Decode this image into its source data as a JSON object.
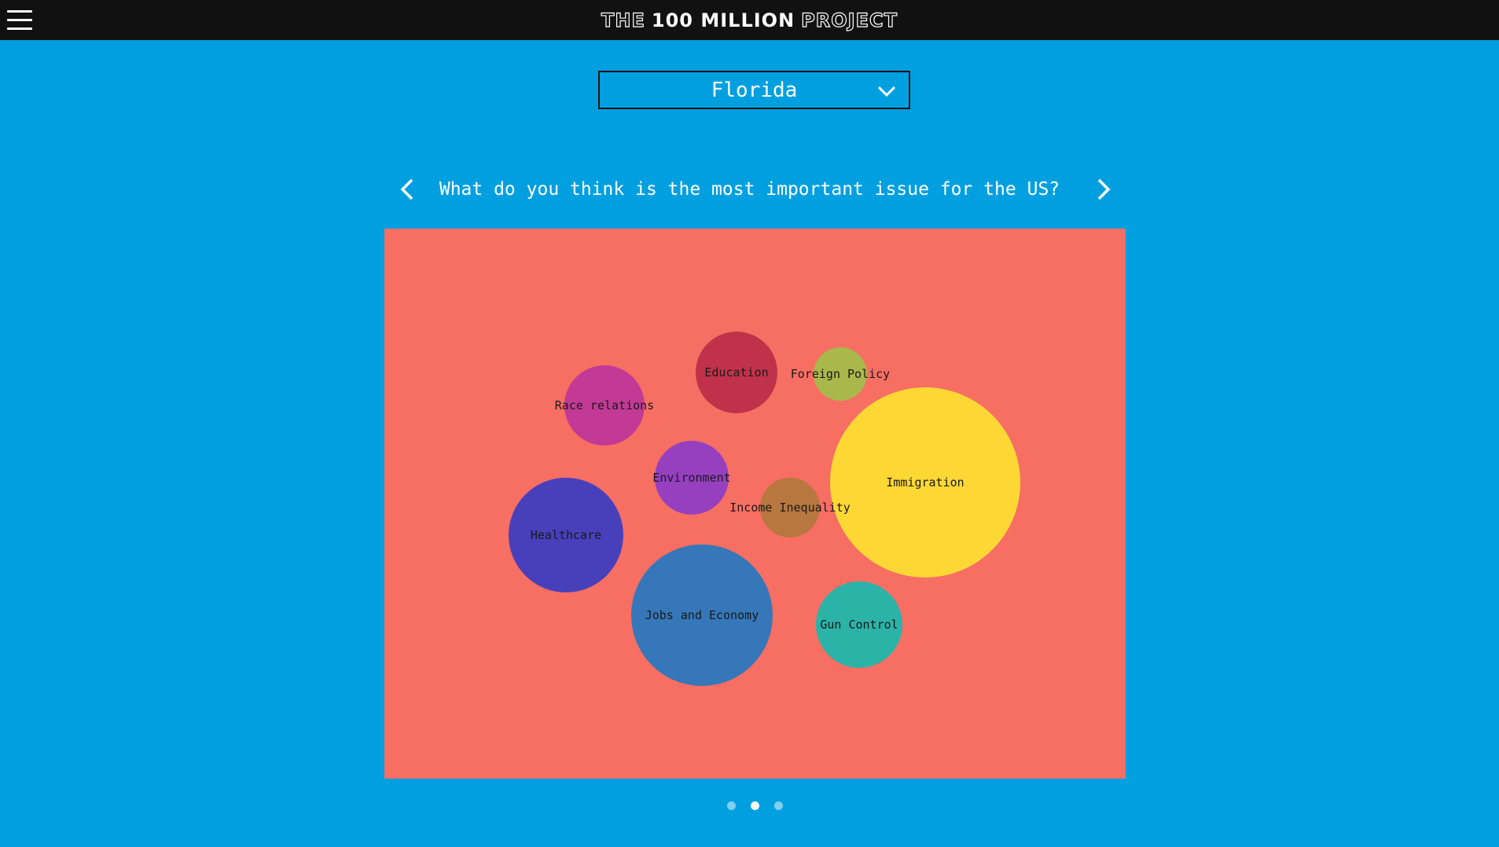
{
  "header": {
    "menu_icon": "hamburger-icon",
    "logo_part1": "THE",
    "logo_part2": "100 MILLION",
    "logo_part3": "PROJECT"
  },
  "state_select": {
    "selected": "Florida",
    "icon": "chevron-down-icon"
  },
  "question": {
    "text": "What do you think is the most important issue for the US?",
    "prev_icon": "chevron-left-icon",
    "next_icon": "chevron-right-icon"
  },
  "colors": {
    "page_bg": "#00a0e0",
    "topbar_bg": "#111111",
    "panel_bg": "#f76e63"
  },
  "chart_data": {
    "type": "bubble",
    "bubbles": [
      {
        "label": "Education",
        "color": "#c1324a"
      },
      {
        "label": "Foreign Policy",
        "color": "#a8b84b"
      },
      {
        "label": "Race relations",
        "color": "#c23a96"
      },
      {
        "label": "Environment",
        "color": "#9640c0"
      },
      {
        "label": "Income Inequality",
        "color": "#b8773f"
      },
      {
        "label": "Immigration",
        "color": "#fdd835"
      },
      {
        "label": "Healthcare",
        "color": "#4840bb"
      },
      {
        "label": "Jobs and Economy",
        "color": "#3577b8"
      },
      {
        "label": "Gun Control",
        "color": "#2bb3a8"
      }
    ]
  },
  "pagination": {
    "pages": 3,
    "active": 2
  }
}
